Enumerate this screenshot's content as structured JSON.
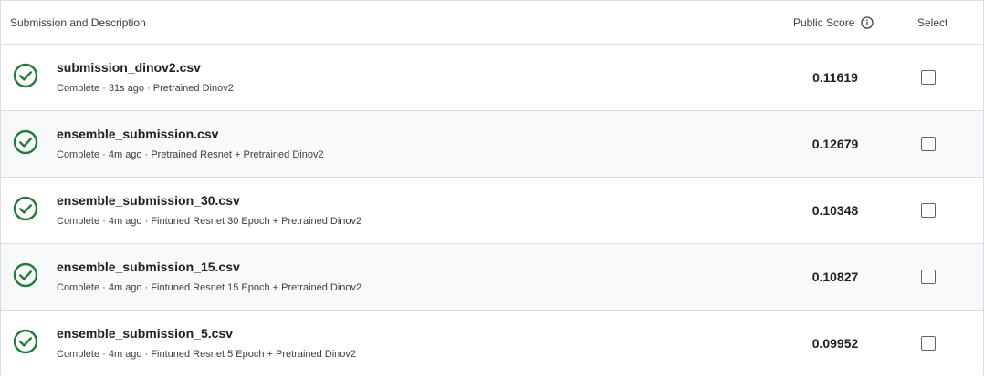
{
  "header": {
    "description_label": "Submission and Description",
    "score_label": "Public Score",
    "select_label": "Select"
  },
  "colors": {
    "success": "#1e7e34",
    "border": "#dadce0",
    "row_alt": "#f8f9fa"
  },
  "rows": [
    {
      "file": "submission_dinov2.csv",
      "meta": "Complete · 31s ago · Pretrained Dinov2",
      "score": "0.11619",
      "status_icon": "check-circle-icon"
    },
    {
      "file": "ensemble_submission.csv",
      "meta": "Complete · 4m ago · Pretrained Resnet + Pretrained Dinov2",
      "score": "0.12679",
      "status_icon": "check-circle-icon"
    },
    {
      "file": "ensemble_submission_30.csv",
      "meta": "Complete · 4m ago · Fintuned Resnet 30 Epoch + Pretrained Dinov2",
      "score": "0.10348",
      "status_icon": "check-circle-icon"
    },
    {
      "file": "ensemble_submission_15.csv",
      "meta": "Complete · 4m ago · Fintuned Resnet 15 Epoch + Pretrained Dinov2",
      "score": "0.10827",
      "status_icon": "check-circle-icon"
    },
    {
      "file": "ensemble_submission_5.csv",
      "meta": "Complete · 4m ago · Fintuned Resnet 5 Epoch + Pretrained Dinov2",
      "score": "0.09952",
      "status_icon": "check-circle-icon"
    }
  ]
}
